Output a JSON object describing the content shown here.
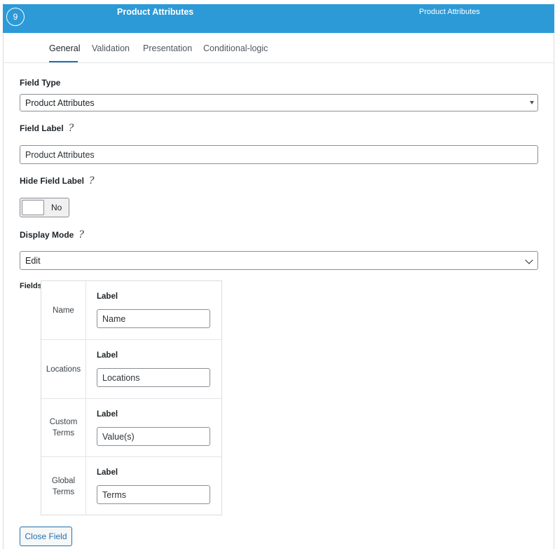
{
  "header": {
    "order": "9",
    "title": "Product Attributes",
    "type": "Product Attributes"
  },
  "tabs": [
    {
      "label": "General",
      "active": true
    },
    {
      "label": "Validation",
      "active": false
    },
    {
      "label": "Presentation",
      "active": false
    },
    {
      "label": "Conditional-logic",
      "active": false
    }
  ],
  "general": {
    "field_type": {
      "label": "Field Type",
      "value": "Product Attributes"
    },
    "field_label": {
      "label": "Field Label",
      "value": "Product Attributes"
    },
    "hide_field_label": {
      "label": "Hide Field Label",
      "value": "No"
    },
    "display_mode": {
      "label": "Display Mode",
      "value": "Edit"
    },
    "fields": {
      "label": "Fields",
      "rows": [
        {
          "name": "Name",
          "label": "Label",
          "value": "Name"
        },
        {
          "name": "Locations",
          "label": "Label",
          "value": "Locations"
        },
        {
          "name": "Custom Terms",
          "label": "Label",
          "value": "Value(s)"
        },
        {
          "name": "Global Terms",
          "label": "Label",
          "value": "Terms"
        }
      ]
    }
  },
  "help_glyph": "?",
  "close_button": "Close Field",
  "colors": {
    "header_bg": "#2c9ad7",
    "accent": "#2271b1"
  }
}
